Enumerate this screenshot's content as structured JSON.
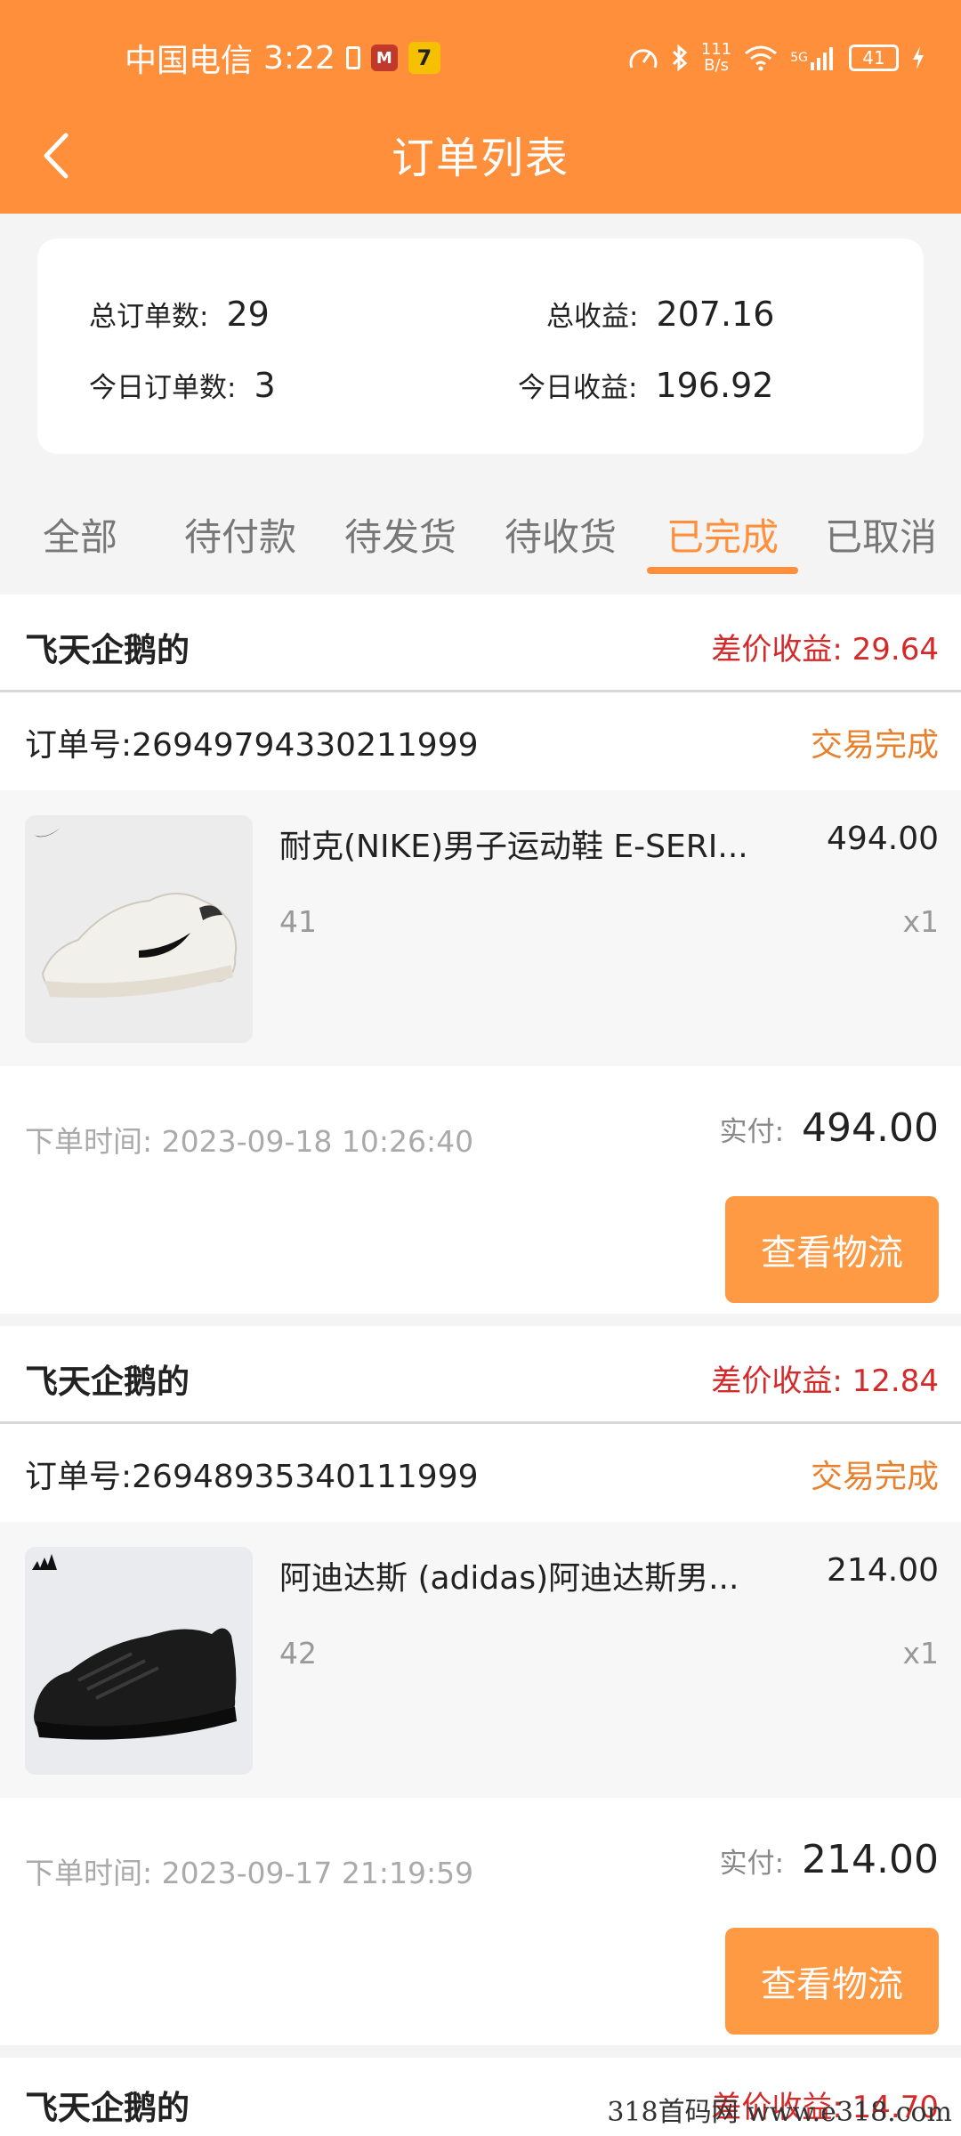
{
  "status_bar": {
    "carrier": "中国电信",
    "time": "3:22",
    "net_speed_value": "111",
    "net_speed_unit": "B/s",
    "signal_tag": "5G",
    "battery": "41"
  },
  "header": {
    "title": "订单列表"
  },
  "summary": {
    "total_orders_label": "总订单数:",
    "total_orders": "29",
    "total_income_label": "总收益:",
    "total_income": "207.16",
    "today_orders_label": "今日订单数:",
    "today_orders": "3",
    "today_income_label": "今日收益:",
    "today_income": "196.92"
  },
  "tabs": [
    {
      "label": "全部"
    },
    {
      "label": "待付款"
    },
    {
      "label": "待发货"
    },
    {
      "label": "待收货"
    },
    {
      "label": "已完成"
    },
    {
      "label": "已取消"
    }
  ],
  "active_tab": "已完成",
  "orders": [
    {
      "shop": "飞天企鹅的",
      "profit": "差价收益: 29.64",
      "order_no": "订单号:26949794330211999",
      "status": "交易完成",
      "product_name": "耐克(NIKE)男子运动鞋 E-SERI...",
      "price": "494.00",
      "size": "41",
      "qty": "x1",
      "time": "下单时间: 2023-09-18 10:26:40",
      "paid_label": "实付:",
      "paid": "494.00",
      "button": "查看物流"
    },
    {
      "shop": "飞天企鹅的",
      "profit": "差价收益: 12.84",
      "order_no": "订单号:26948935340111999",
      "status": "交易完成",
      "product_name": "阿迪达斯 (adidas)阿迪达斯男...",
      "price": "214.00",
      "size": "42",
      "qty": "x1",
      "time": "下单时间: 2023-09-17 21:19:59",
      "paid_label": "实付:",
      "paid": "214.00",
      "button": "查看物流"
    },
    {
      "shop": "飞天企鹅的",
      "profit": "差价收益: 14.70"
    }
  ],
  "watermark": "318首码网 www.e318.com",
  "colors": {
    "accent": "#ff8f3b",
    "profit_red": "#d52a2a",
    "status_orange": "#e8812e"
  }
}
